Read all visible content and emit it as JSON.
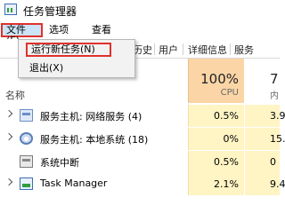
{
  "window": {
    "title": "任务管理器",
    "icon": "task-manager-icon"
  },
  "menu": {
    "file": "文件(F)",
    "options": "选项(O)",
    "view": "查看(V)"
  },
  "tabs": {
    "partial": "历史",
    "users": "用户",
    "details": "详细信息",
    "services": "服务"
  },
  "file_menu": {
    "run_new_task": "运行新任务(N)",
    "exit": "退出(X)"
  },
  "columns": {
    "name": "名称",
    "cpu_total": "100%",
    "cpu": "CPU",
    "mem_total": "7",
    "mem": "内"
  },
  "processes": [
    {
      "name": "服务主机: 网络服务 (4)",
      "cpu": "0.5%",
      "mem": "3.9",
      "icon": "service-host-icon"
    },
    {
      "name": "服务主机: 本地系统 (18)",
      "cpu": "0%",
      "mem": "15.8",
      "icon": "service-host-gear-icon"
    },
    {
      "name": "系统中断",
      "cpu": "0.5%",
      "mem": "0",
      "icon": "system-icon"
    },
    {
      "name": "Task Manager",
      "cpu": "2.1%",
      "mem": "9.4",
      "icon": "task-manager-icon"
    }
  ],
  "colors": {
    "highlight": "#e0312c",
    "cpu_header": "#fbd5a6",
    "cell_bg": "#fff4c4"
  }
}
